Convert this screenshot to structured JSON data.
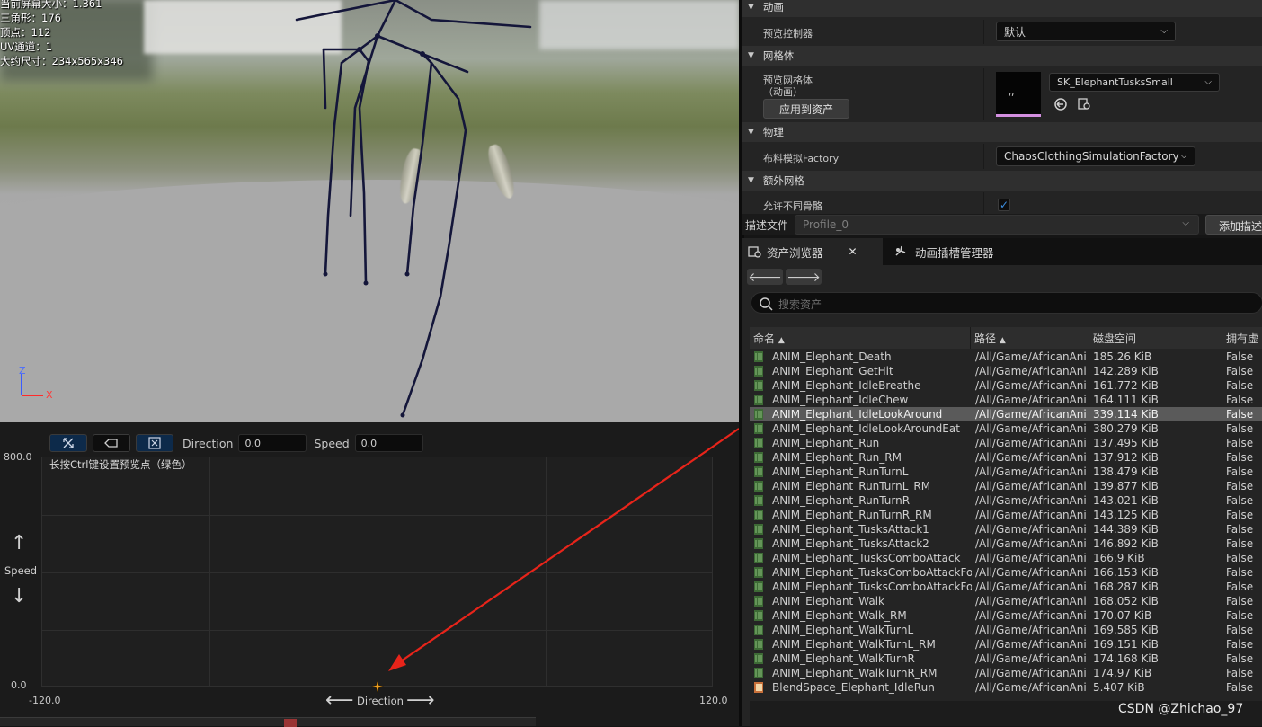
{
  "viewport": {
    "stats": [
      "当前屏幕大小：1.361",
      "三角形：176",
      "顶点：112",
      "UV通道：1",
      "大约尺寸：234x565x346"
    ],
    "axis": {
      "z": "Z",
      "x": "X"
    }
  },
  "blendspace": {
    "toolbar": {
      "direction_label": "Direction",
      "direction_value": "0.0",
      "speed_label": "Speed",
      "speed_value": "0.0"
    },
    "hint": "长按Ctrl键设置预览点（绿色）",
    "y_axis": {
      "name": "Speed",
      "max": "800.0",
      "min": "0.0"
    },
    "x_axis": {
      "name": "Direction",
      "min": "-120.0",
      "max": "120.0"
    },
    "sample": {
      "direction": 0.0,
      "speed": 0.0
    }
  },
  "details": {
    "categories": {
      "animation": "动画",
      "mesh": "网格体",
      "physics": "物理",
      "extra_mesh": "额外网格"
    },
    "preview_controller": {
      "label": "预览控制器",
      "value": "默认"
    },
    "preview_mesh": {
      "label_line1": "预览网格体",
      "label_line2": "（动画）",
      "value": "SK_ElephantTusksSmall",
      "apply_button": "应用到资产"
    },
    "cloth_factory": {
      "label": "布料模拟Factory",
      "value": "ChaosClothingSimulationFactory"
    },
    "allow_diff_skeleton": {
      "label": "允许不同骨骼",
      "checked": true
    }
  },
  "profile": {
    "label": "描述文件",
    "value": "Profile_0",
    "add_button": "添加描述"
  },
  "tabs": [
    {
      "label": "资产浏览器",
      "active": true
    },
    {
      "label": "动画插槽管理器",
      "active": false
    }
  ],
  "content_browser": {
    "search_placeholder": "搜索资产",
    "columns": {
      "name": "命名",
      "path": "路径",
      "size": "磁盘空间",
      "virtual": "拥有虚"
    },
    "rows": [
      {
        "name": "ANIM_Elephant_Death",
        "path": "/All/Game/AfricanAni",
        "size": "185.26 KiB",
        "virtual": "False"
      },
      {
        "name": "ANIM_Elephant_GetHit",
        "path": "/All/Game/AfricanAni",
        "size": "142.289 KiB",
        "virtual": "False"
      },
      {
        "name": "ANIM_Elephant_IdleBreathe",
        "path": "/All/Game/AfricanAni",
        "size": "161.772 KiB",
        "virtual": "False"
      },
      {
        "name": "ANIM_Elephant_IdleChew",
        "path": "/All/Game/AfricanAni",
        "size": "164.111 KiB",
        "virtual": "False"
      },
      {
        "name": "ANIM_Elephant_IdleLookAround",
        "path": "/All/Game/AfricanAni",
        "size": "339.114 KiB",
        "virtual": "False",
        "selected": true
      },
      {
        "name": "ANIM_Elephant_IdleLookAroundEat",
        "path": "/All/Game/AfricanAni",
        "size": "380.279 KiB",
        "virtual": "False"
      },
      {
        "name": "ANIM_Elephant_Run",
        "path": "/All/Game/AfricanAni",
        "size": "137.495 KiB",
        "virtual": "False"
      },
      {
        "name": "ANIM_Elephant_Run_RM",
        "path": "/All/Game/AfricanAni",
        "size": "137.912 KiB",
        "virtual": "False"
      },
      {
        "name": "ANIM_Elephant_RunTurnL",
        "path": "/All/Game/AfricanAni",
        "size": "138.479 KiB",
        "virtual": "False"
      },
      {
        "name": "ANIM_Elephant_RunTurnL_RM",
        "path": "/All/Game/AfricanAni",
        "size": "139.877 KiB",
        "virtual": "False"
      },
      {
        "name": "ANIM_Elephant_RunTurnR",
        "path": "/All/Game/AfricanAni",
        "size": "143.021 KiB",
        "virtual": "False"
      },
      {
        "name": "ANIM_Elephant_RunTurnR_RM",
        "path": "/All/Game/AfricanAni",
        "size": "143.125 KiB",
        "virtual": "False"
      },
      {
        "name": "ANIM_Elephant_TusksAttack1",
        "path": "/All/Game/AfricanAni",
        "size": "144.389 KiB",
        "virtual": "False"
      },
      {
        "name": "ANIM_Elephant_TusksAttack2",
        "path": "/All/Game/AfricanAni",
        "size": "146.892 KiB",
        "virtual": "False"
      },
      {
        "name": "ANIM_Elephant_TusksComboAttack",
        "path": "/All/Game/AfricanAni",
        "size": "166.9 KiB",
        "virtual": "False"
      },
      {
        "name": "ANIM_Elephant_TusksComboAttackFo",
        "path": "/All/Game/AfricanAni",
        "size": "166.153 KiB",
        "virtual": "False"
      },
      {
        "name": "ANIM_Elephant_TusksComboAttackFo",
        "path": "/All/Game/AfricanAni",
        "size": "168.287 KiB",
        "virtual": "False"
      },
      {
        "name": "ANIM_Elephant_Walk",
        "path": "/All/Game/AfricanAni",
        "size": "168.052 KiB",
        "virtual": "False"
      },
      {
        "name": "ANIM_Elephant_Walk_RM",
        "path": "/All/Game/AfricanAni",
        "size": "170.07 KiB",
        "virtual": "False"
      },
      {
        "name": "ANIM_Elephant_WalkTurnL",
        "path": "/All/Game/AfricanAni",
        "size": "169.585 KiB",
        "virtual": "False"
      },
      {
        "name": "ANIM_Elephant_WalkTurnL_RM",
        "path": "/All/Game/AfricanAni",
        "size": "169.151 KiB",
        "virtual": "False"
      },
      {
        "name": "ANIM_Elephant_WalkTurnR",
        "path": "/All/Game/AfricanAni",
        "size": "174.168 KiB",
        "virtual": "False"
      },
      {
        "name": "ANIM_Elephant_WalkTurnR_RM",
        "path": "/All/Game/AfricanAni",
        "size": "174.97 KiB",
        "virtual": "False"
      },
      {
        "name": "BlendSpace_Elephant_IdleRun",
        "path": "/All/Game/AfricanAni",
        "size": "5.407 KiB",
        "virtual": "False",
        "type": "blendspace"
      }
    ]
  },
  "watermark": "CSDN @Zhichao_97",
  "colors": {
    "accent_blue": "#0d2a4a",
    "selection": "#5a5a5a",
    "annotation_arrow": "#e8241a",
    "anim_icon": "#5a8a4a",
    "bone": "#14163a"
  }
}
